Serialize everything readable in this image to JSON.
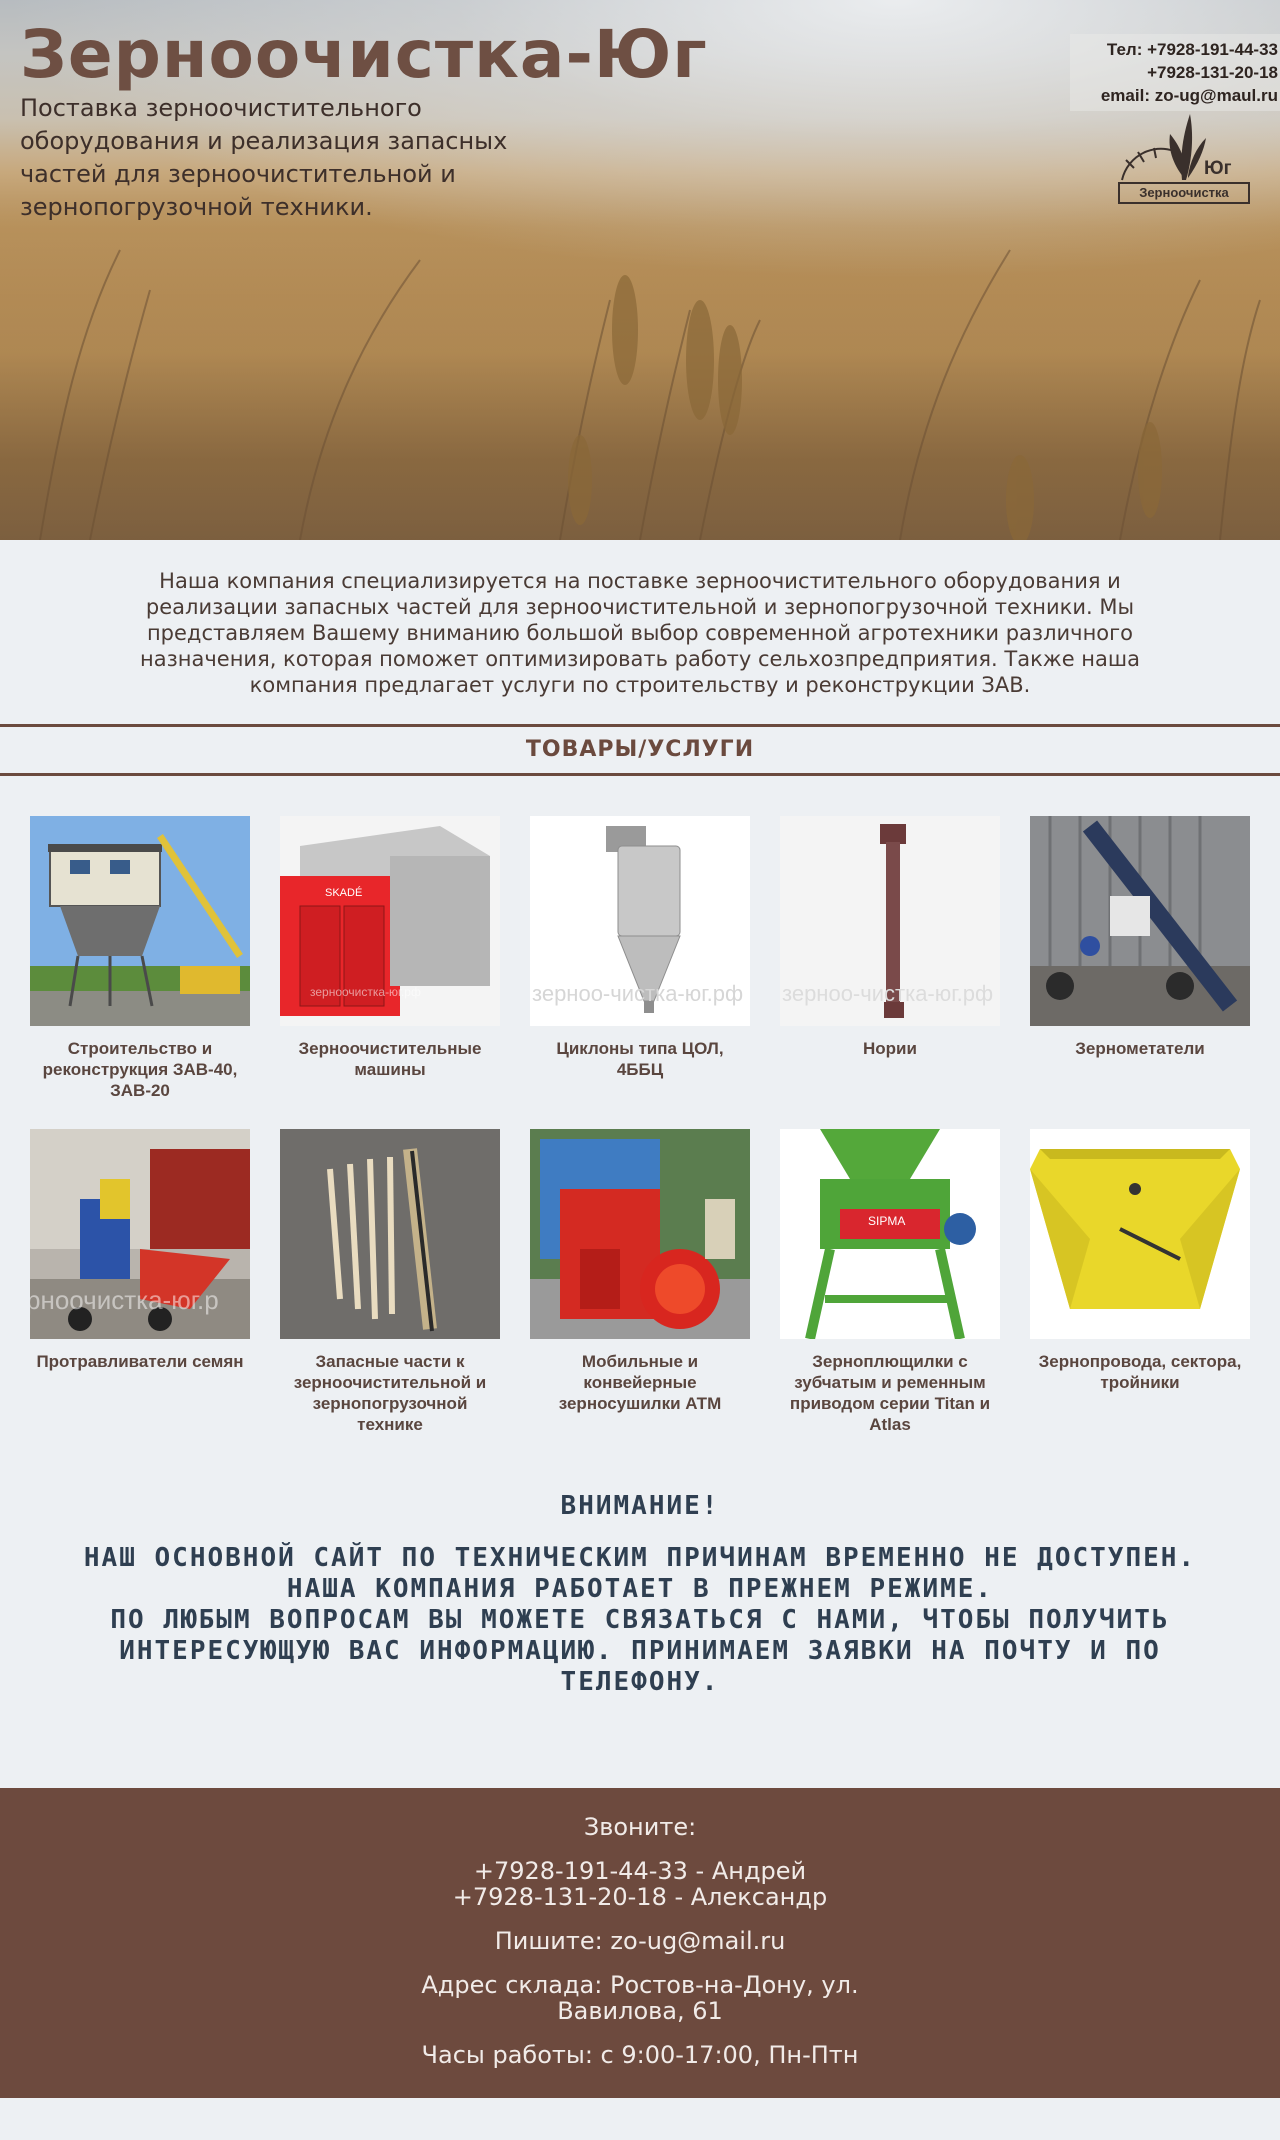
{
  "header": {
    "title": "Зерноочистка-Юг",
    "subtitle": "Поставка зерноочистительного оборудования и реализация запасных частей для зерноочистительной и зернопогрузочной техники.",
    "contacts": {
      "phone_line": "Тел: +7928-191-44-33",
      "phone2": "+7928-131-20-18",
      "email_line": "email: zo-ug@maul.ru"
    },
    "logo": {
      "big_text": "Юг",
      "small_text": "Зерноочистка"
    }
  },
  "intro": "Наша компания специализируется на поставке зерноочистительного оборудования и реализации запасных частей для зерноочистительной и зернопогрузочной техники. Мы представляем Вашему вниманию большой выбор современной агротехники различного назначения, которая поможет оптимизировать работу сельхозпредприятия. Также наша компания предлагает услуги по строительству и реконструкции ЗАВ.",
  "products": {
    "heading": "ТОВАРЫ/УСЛУГИ",
    "items": [
      {
        "label": "Строительство и реконструкция ЗАВ-40, ЗАВ-20",
        "icon": "zav-tower-photo"
      },
      {
        "label": "Зерноочистительные машины",
        "icon": "red-grain-cleaner-photo"
      },
      {
        "label": "Циклоны типа ЦОЛ, 4ББЦ",
        "icon": "cyclone-photo"
      },
      {
        "label": "Нории",
        "icon": "bucket-elevator-photo"
      },
      {
        "label": "Зернометатели",
        "icon": "grain-thrower-photo"
      },
      {
        "label": "Протравливатели семян",
        "icon": "seed-treater-photo"
      },
      {
        "label": "Запасные части к зерноочистительной и зернопогрузочной технике",
        "icon": "spare-parts-photo"
      },
      {
        "label": "Мобильные и конвейерные зерносушилки АТМ",
        "icon": "grain-dryer-photo"
      },
      {
        "label": "Зерноплющилки с зубчатым и ременным приводом серии Titan и Atlas",
        "icon": "grain-flaker-photo"
      },
      {
        "label": "Зернопровода, сектора, тройники",
        "icon": "grain-pipe-photo"
      }
    ],
    "watermark": "зерноочистка-юг.рф"
  },
  "notice": {
    "title": "ВНИМАНИЕ!",
    "line1": "НАШ ОСНОВНОЙ САЙТ ПО ТЕХНИЧЕСКИМ ПРИЧИНАМ ВРЕМЕННО НЕ ДОСТУПЕН. НАША КОМПАНИЯ РАБОТАЕТ В ПРЕЖНЕМ РЕЖИМЕ.",
    "line2": "ПО ЛЮБЫМ ВОПРОСАМ ВЫ МОЖЕТЕ СВЯЗАТЬСЯ С НАМИ, ЧТОБЫ ПОЛУЧИТЬ ИНТЕРЕСУЮЩУЮ ВАС ИНФОРМАЦИЮ. ПРИНИМАЕМ ЗАЯВКИ НА ПОЧТУ И ПО ТЕЛЕФОНУ."
  },
  "footer": {
    "call_label": "Звоните:",
    "phone1": "+7928-191-44-33 - Андрей",
    "phone2": "+7928-131-20-18 - Александр",
    "write": "Пишите: zo-ug@mail.ru",
    "address": "Адрес склада: Ростов-на-Дону, ул. Вавилова, 61",
    "hours": "Часы работы: с 9:00-17:00, Пн-Птн"
  },
  "colors": {
    "brand_brown": "#6d4a3e",
    "notice_text": "#2f3f51",
    "page_bg": "#edf0f3"
  }
}
